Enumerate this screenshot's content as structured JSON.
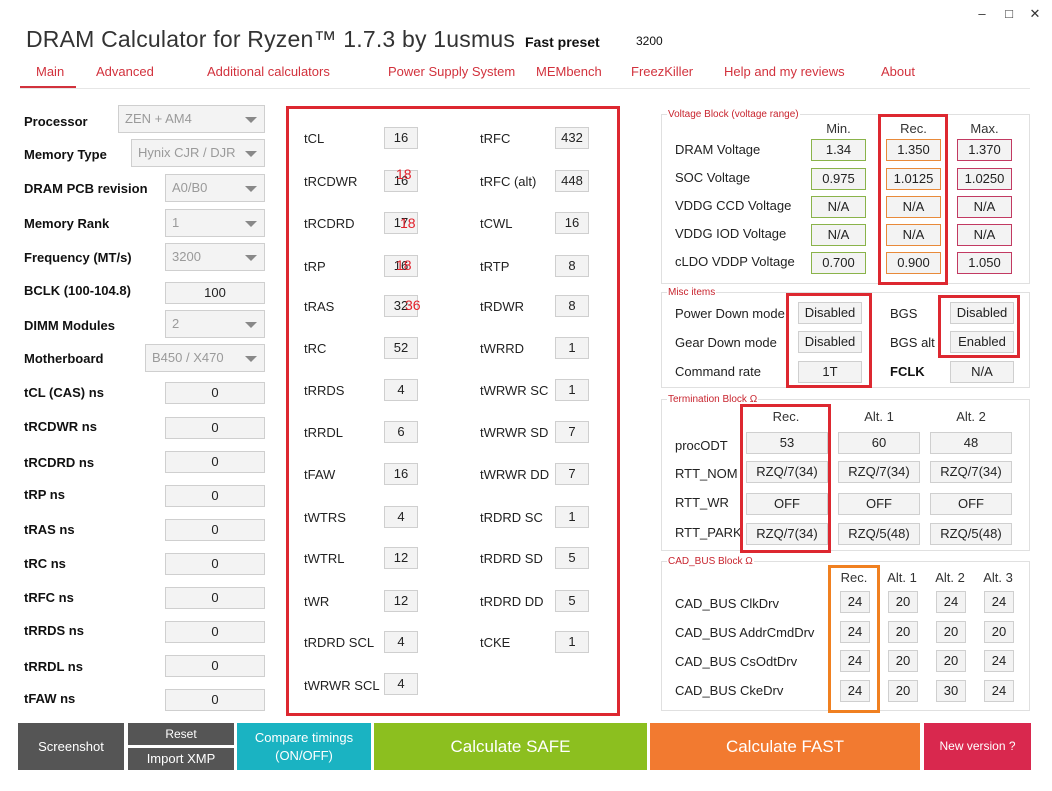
{
  "window": {
    "title": "DRAM Calculator for Ryzen™ 1.7.3 by 1usmus",
    "min": "–",
    "max": "□",
    "close": "✕"
  },
  "preset": {
    "label": "Fast preset",
    "value": "3200"
  },
  "nav": [
    "Main",
    "Advanced",
    "Additional calculators",
    "Power Supply System",
    "MEMbench",
    "FreezKiller",
    "Help and my reviews",
    "About"
  ],
  "left": {
    "processor": {
      "label": "Processor",
      "value": "ZEN + AM4"
    },
    "memory_type": {
      "label": "Memory Type",
      "value": "Hynix CJR / DJR"
    },
    "pcb": {
      "label": "DRAM PCB revision",
      "value": "A0/B0"
    },
    "rank": {
      "label": "Memory Rank",
      "value": "1"
    },
    "freq": {
      "label": "Frequency (MT/s)",
      "value": "3200"
    },
    "bclk": {
      "label": "BCLK (100-104.8)",
      "value": "100"
    },
    "dimm": {
      "label": "DIMM Modules",
      "value": "2"
    },
    "mobo": {
      "label": "Motherboard",
      "value": "B450 / X470"
    },
    "ns": [
      {
        "label": "tCL (CAS) ns",
        "value": "0"
      },
      {
        "label": "tRCDWR ns",
        "value": "0"
      },
      {
        "label": "tRCDRD ns",
        "value": "0"
      },
      {
        "label": "tRP ns",
        "value": "0"
      },
      {
        "label": "tRAS ns",
        "value": "0"
      },
      {
        "label": "tRC ns",
        "value": "0"
      },
      {
        "label": "tRFC ns",
        "value": "0"
      },
      {
        "label": "tRRDS ns",
        "value": "0"
      },
      {
        "label": "tRRDL ns",
        "value": "0"
      },
      {
        "label": "tFAW ns",
        "value": "0"
      }
    ]
  },
  "timings_left": [
    {
      "label": "tCL",
      "value": "16",
      "overlay": ""
    },
    {
      "label": "tRCDWR",
      "value": "16",
      "overlay": "18"
    },
    {
      "label": "tRCDRD",
      "value": "17",
      "overlay": "18"
    },
    {
      "label": "tRP",
      "value": "16",
      "overlay": "18"
    },
    {
      "label": "tRAS",
      "value": "32",
      "overlay": "36"
    },
    {
      "label": "tRC",
      "value": "52",
      "overlay": ""
    },
    {
      "label": "tRRDS",
      "value": "4",
      "overlay": ""
    },
    {
      "label": "tRRDL",
      "value": "6",
      "overlay": ""
    },
    {
      "label": "tFAW",
      "value": "16",
      "overlay": ""
    },
    {
      "label": "tWTRS",
      "value": "4",
      "overlay": ""
    },
    {
      "label": "tWTRL",
      "value": "12",
      "overlay": ""
    },
    {
      "label": "tWR",
      "value": "12",
      "overlay": ""
    },
    {
      "label": "tRDRD SCL",
      "value": "4",
      "overlay": ""
    },
    {
      "label": "tWRWR SCL",
      "value": "4",
      "overlay": ""
    }
  ],
  "timings_right": [
    {
      "label": "tRFC",
      "value": "432"
    },
    {
      "label": "tRFC (alt)",
      "value": "448"
    },
    {
      "label": "tCWL",
      "value": "16"
    },
    {
      "label": "tRTP",
      "value": "8"
    },
    {
      "label": "tRDWR",
      "value": "8"
    },
    {
      "label": "tWRRD",
      "value": "1"
    },
    {
      "label": "tWRWR SC",
      "value": "1"
    },
    {
      "label": "tWRWR SD",
      "value": "7"
    },
    {
      "label": "tWRWR DD",
      "value": "7"
    },
    {
      "label": "tRDRD SC",
      "value": "1"
    },
    {
      "label": "tRDRD SD",
      "value": "5"
    },
    {
      "label": "tRDRD DD",
      "value": "5"
    },
    {
      "label": "tCKE",
      "value": "1"
    }
  ],
  "voltage": {
    "title": "Voltage Block (voltage range)",
    "headers": [
      "Min.",
      "Rec.",
      "Max."
    ],
    "rows": [
      {
        "label": "DRAM Voltage",
        "min": "1.34",
        "rec": "1.350",
        "max": "1.370"
      },
      {
        "label": "SOC Voltage",
        "min": "0.975",
        "rec": "1.0125",
        "max": "1.0250"
      },
      {
        "label": "VDDG  CCD Voltage",
        "min": "N/A",
        "rec": "N/A",
        "max": "N/A"
      },
      {
        "label": "VDDG  IOD Voltage",
        "min": "N/A",
        "rec": "N/A",
        "max": "N/A"
      },
      {
        "label": "cLDO VDDP Voltage",
        "min": "0.700",
        "rec": "0.900",
        "max": "1.050"
      }
    ]
  },
  "misc": {
    "title": "Misc items",
    "power_down": {
      "label": "Power Down mode",
      "value": "Disabled"
    },
    "gear_down": {
      "label": "Gear Down mode",
      "value": "Disabled"
    },
    "command_rate": {
      "label": "Command rate",
      "value": "1T"
    },
    "bgs": {
      "label": "BGS",
      "value": "Disabled"
    },
    "bgs_alt": {
      "label": "BGS alt",
      "value": "Enabled"
    },
    "fclk": {
      "label": "FCLK",
      "value": "N/A"
    }
  },
  "termination": {
    "title": "Termination Block Ω",
    "headers": [
      "Rec.",
      "Alt. 1",
      "Alt. 2"
    ],
    "rows": [
      {
        "label": "procODT",
        "values": [
          "53",
          "60",
          "48"
        ]
      },
      {
        "label": "RTT_NOM",
        "values": [
          "RZQ/7(34)",
          "RZQ/7(34)",
          "RZQ/7(34)"
        ]
      },
      {
        "label": "RTT_WR",
        "values": [
          "OFF",
          "OFF",
          "OFF"
        ]
      },
      {
        "label": "RTT_PARK",
        "values": [
          "RZQ/7(34)",
          "RZQ/5(48)",
          "RZQ/5(48)"
        ]
      }
    ]
  },
  "cadbus": {
    "title": "CAD_BUS Block Ω",
    "headers": [
      "Rec.",
      "Alt. 1",
      "Alt. 2",
      "Alt. 3"
    ],
    "rows": [
      {
        "label": "CAD_BUS ClkDrv",
        "values": [
          "24",
          "20",
          "24",
          "24"
        ]
      },
      {
        "label": "CAD_BUS AddrCmdDrv",
        "values": [
          "24",
          "20",
          "20",
          "20"
        ]
      },
      {
        "label": "CAD_BUS CsOdtDrv",
        "values": [
          "24",
          "20",
          "20",
          "24"
        ]
      },
      {
        "label": "CAD_BUS CkeDrv",
        "values": [
          "24",
          "20",
          "30",
          "24"
        ]
      }
    ]
  },
  "buttons": {
    "screenshot": "Screenshot",
    "reset": "Reset",
    "import_xmp": "Import XMP",
    "compare": "Compare timings (ON/OFF)",
    "safe": "Calculate SAFE",
    "fast": "Calculate FAST",
    "new_version": "New version ?"
  },
  "colors": {
    "accent": "#d2323d",
    "safe": "#8cbf1f",
    "fast": "#f27a30",
    "teal": "#1ab3c2",
    "dark": "#555555",
    "newver": "#d9284e"
  }
}
